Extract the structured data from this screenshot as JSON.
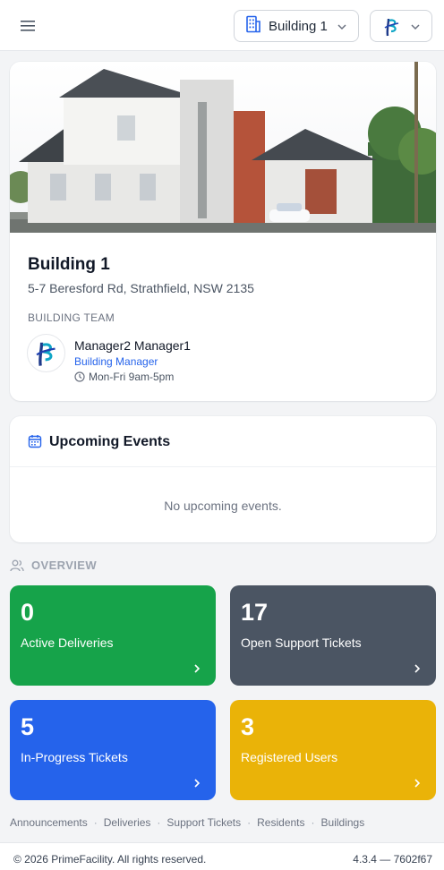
{
  "header": {
    "menu_icon": "hamburger-icon",
    "building_selector": {
      "value": "Building 1",
      "icon": "building-icon"
    },
    "org_selector": {
      "icon": "org-logo"
    }
  },
  "building": {
    "name": "Building 1",
    "address": "5-7 Beresford Rd, Strathfield, NSW 2135",
    "team_label": "BUILDING TEAM",
    "manager": {
      "name": "Manager2 Manager1",
      "role": "Building Manager",
      "hours": "Mon-Fri 9am-5pm"
    }
  },
  "events": {
    "title": "Upcoming Events",
    "empty_text": "No upcoming events."
  },
  "overview": {
    "label": "OVERVIEW",
    "stats": [
      {
        "value": "0",
        "label": "Active Deliveries",
        "color": "#16a34a"
      },
      {
        "value": "17",
        "label": "Open Support Tickets",
        "color": "#4b5563"
      },
      {
        "value": "5",
        "label": "In-Progress Tickets",
        "color": "#2563eb"
      },
      {
        "value": "3",
        "label": "Registered Users",
        "color": "#eab308"
      }
    ]
  },
  "footer_links": [
    "Announcements",
    "Deliveries",
    "Support Tickets",
    "Residents",
    "Buildings"
  ],
  "footer": {
    "copyright": "© 2026 PrimeFacility. All rights reserved.",
    "version": "4.3.4 — 7602f67"
  }
}
